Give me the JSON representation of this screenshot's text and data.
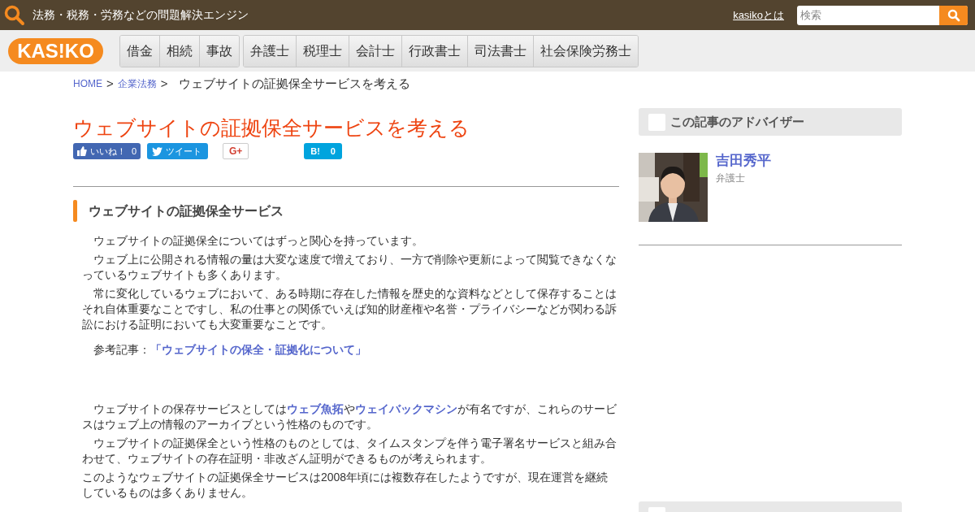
{
  "header": {
    "tagline": "法務・税務・労務などの問題解決エンジン",
    "about_link": "kasikoとは",
    "search": {
      "placeholder": "検索"
    }
  },
  "logo": "KAS!KO",
  "nav_groups": [
    {
      "items": [
        "借金",
        "相続",
        "事故"
      ]
    },
    {
      "items": [
        "弁護士",
        "税理士",
        "会計士",
        "行政書士",
        "司法書士",
        "社会保険労務士"
      ]
    }
  ],
  "breadcrumb": [
    {
      "kind": "link",
      "text": "HOME"
    },
    {
      "kind": "separator",
      "text": ">"
    },
    {
      "kind": "link",
      "text": "企業法務"
    },
    {
      "kind": "separator",
      "text": ">"
    },
    {
      "kind": "current",
      "text": "ウェブサイトの証拠保全サービスを考える"
    }
  ],
  "article": {
    "title": "ウェブサイトの証拠保全サービスを考える",
    "share_buttons": [
      {
        "kind": "facebook",
        "label": "いいね！",
        "count": "0"
      },
      {
        "kind": "twitter",
        "label": "ツイート"
      },
      {
        "kind": "googleplus",
        "label": "G+"
      },
      {
        "kind": "hatena",
        "label": "B!",
        "count": "0"
      }
    ],
    "section_heading": "ウェブサイトの証拠保全サービス",
    "paragraphs": [
      {
        "kind": "body",
        "parts": [
          {
            "kind": "text",
            "text": "　ウェブサイトの証拠保全についてはずっと関心を持っています。"
          }
        ]
      },
      {
        "kind": "body",
        "parts": [
          {
            "kind": "text",
            "text": "　ウェブ上に公開される情報の量は大変な速度で増えており、一方で削除や更新によって閲覧できなくなっているウェブサイトも多くあります。"
          }
        ]
      },
      {
        "kind": "body",
        "parts": [
          {
            "kind": "text",
            "text": "　常に変化しているウェブにおいて、ある時期に存在した情報を歴史的な資料などとして保存することはそれ自体重要なことですし、私の仕事との関係でいえば知的財産権や名誉・プライバシーなどが関わる訴訟における証明においても大変重要なことです。"
          }
        ]
      },
      {
        "kind": "reference",
        "parts": [
          {
            "kind": "text",
            "text": "　参考記事："
          },
          {
            "kind": "link",
            "text": "「ウェブサイトの保全・証拠化について」"
          }
        ]
      },
      {
        "kind": "spaced",
        "parts": [
          {
            "kind": "text",
            "text": "　ウェブサイトの保存サービスとしては"
          },
          {
            "kind": "link",
            "text": "ウェブ魚拓"
          },
          {
            "kind": "text",
            "text": "や"
          },
          {
            "kind": "link",
            "text": "ウェイバックマシン"
          },
          {
            "kind": "text",
            "text": "が有名ですが、これらのサービスはウェブ上の情報のアーカイブという性格のものです。"
          }
        ]
      },
      {
        "kind": "body",
        "parts": [
          {
            "kind": "text",
            "text": "　ウェブサイトの証拠保全という性格のものとしては、タイムスタンプを伴う電子署名サービスと組み合わせて、ウェブサイトの存在証明・非改ざん証明ができるものが考えられます。"
          }
        ]
      },
      {
        "kind": "body",
        "parts": [
          {
            "kind": "text",
            "text": "このようなウェブサイトの証拠保全サービスは2008年頃には複数存在したようですが、現在運営を継続しているものは多くありません。"
          }
        ]
      }
    ]
  },
  "sidebar": {
    "advisor_heading": "この記事のアドバイザー",
    "advisor": {
      "name": "吉田秀平",
      "role": "弁護士"
    }
  }
}
